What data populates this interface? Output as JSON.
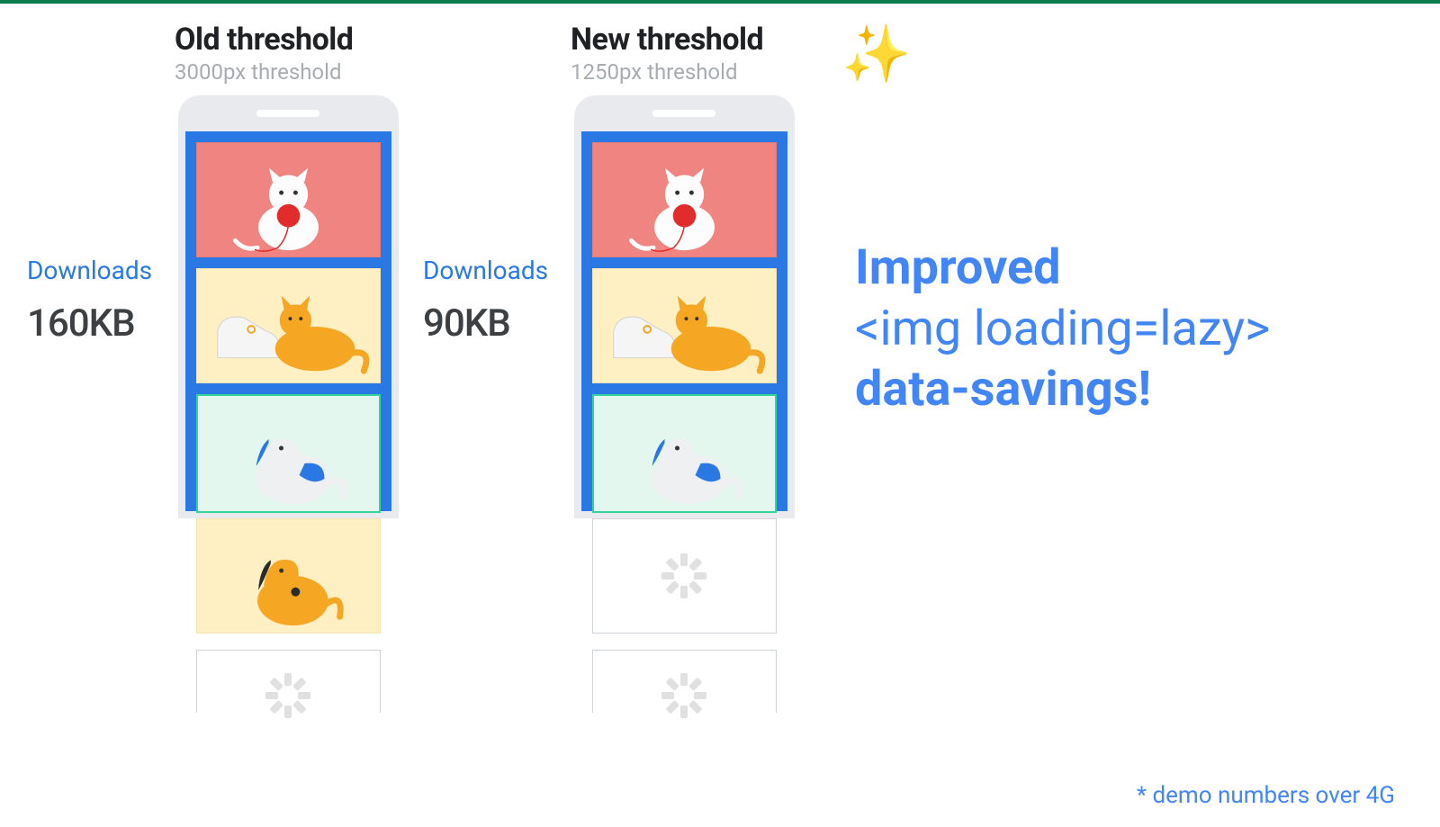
{
  "old": {
    "title": "Old threshold",
    "subtitle": "3000px threshold",
    "downloads_label": "Downloads",
    "downloads_value": "160KB"
  },
  "new": {
    "title": "New threshold",
    "subtitle": "1250px threshold",
    "downloads_label": "Downloads",
    "downloads_value": "90KB"
  },
  "sparkle": "✨",
  "headline": {
    "line1": "Improved",
    "line2": "<img loading=lazy>",
    "line3": "data-savings!"
  },
  "footnote": "* demo numbers over 4G",
  "icons": {
    "cat_yarn": "cat-with-yarn",
    "cat_sneaker": "orange-cat-sneaker",
    "dog_blue": "white-dog-blue-spots",
    "dog_yellow": "yellow-dog",
    "spinner": "loading-spinner"
  }
}
